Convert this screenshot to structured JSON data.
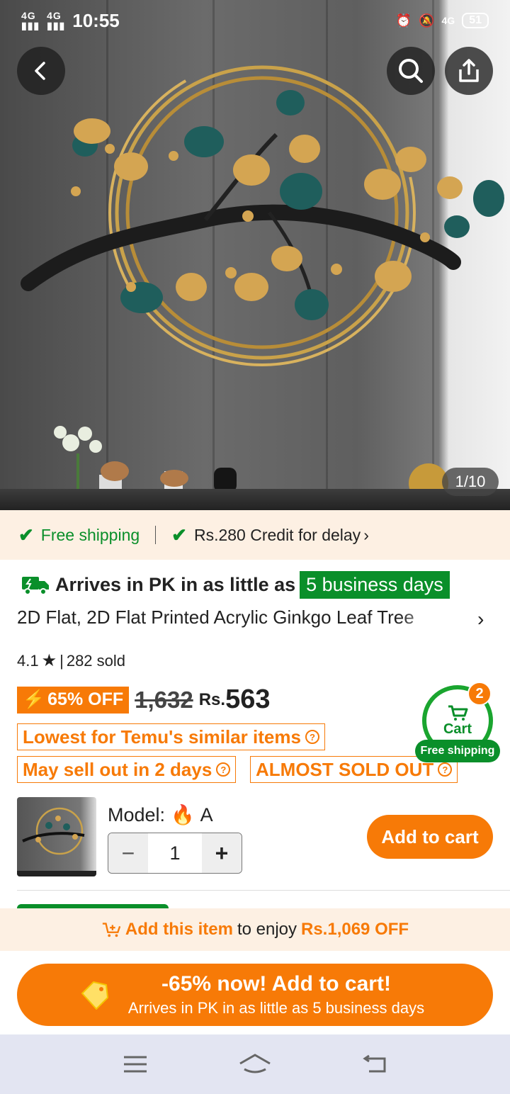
{
  "status_bar": {
    "network_1": "4G",
    "network_2": "4G",
    "time": "10:55",
    "network_3": "4G",
    "battery": "51"
  },
  "gallery": {
    "counter": "1/10"
  },
  "shipping_bar": {
    "free_shipping": "Free shipping",
    "credit": "Rs.280 Credit for delay"
  },
  "delivery": {
    "arrives_text": "Arrives in PK in as little as",
    "days_badge": "5 business days"
  },
  "product": {
    "title": "2D Flat, 2D Flat Printed Acrylic Ginkgo Leaf Tree",
    "rating": "4.1",
    "sold": "282 sold",
    "discount_badge": "65% OFF",
    "old_price": "1,632",
    "currency": "Rs.",
    "price": "563",
    "tag_lowest": "Lowest for Temu's similar items",
    "tag_sellout": "May sell out in 2 days",
    "tag_almost": "ALMOST SOLD OUT",
    "model_label": "Model:",
    "model_value": "A",
    "quantity": "1",
    "add_to_cart": "Add to cart"
  },
  "cart_widget": {
    "label": "Cart",
    "count": "2",
    "free_shipping": "Free shipping"
  },
  "promo_bar": {
    "add_item": "Add this item",
    "middle": "to enjoy",
    "amount": "Rs.1,069 OFF"
  },
  "cta": {
    "line1": "-65% now! Add to cart!",
    "line2": "Arrives in PK in as little as 5 business days"
  },
  "colors": {
    "accent_orange": "#f77a07",
    "accent_green": "#0a8f2a"
  }
}
